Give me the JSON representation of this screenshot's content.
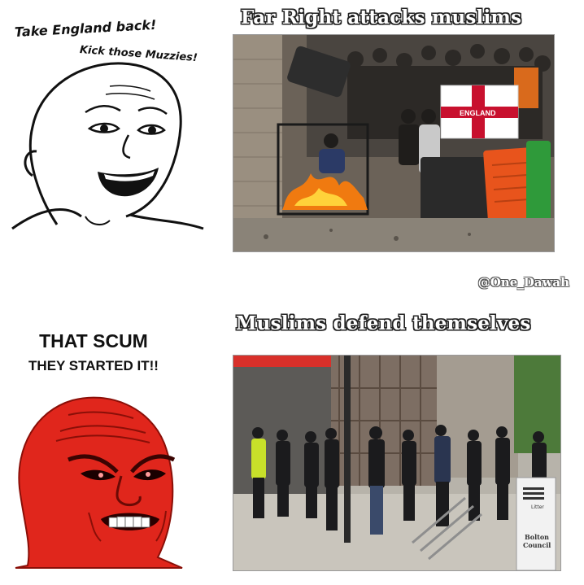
{
  "panel_top": {
    "caption_line1": "Take England back!",
    "caption_line2": "Kick those Muzzies!",
    "title": "Far Right attacks muslims",
    "flag_text": "ENGLAND"
  },
  "watermark": "@One_Dawah",
  "panel_bottom": {
    "caption_line1": "THAT SCUM",
    "caption_line2": "THEY STARTED IT!!",
    "title": "Muslims defend themselves",
    "sign_text_top": "Litter",
    "sign_text_bottom1": "Bolton",
    "sign_text_bottom2": "Council"
  },
  "colors": {
    "angry_face": "#e0261c",
    "fire": "#f07a10",
    "bin_orange": "#e8541c",
    "bin_green": "#2f9a3a"
  }
}
